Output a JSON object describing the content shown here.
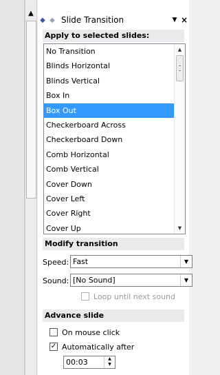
{
  "pane": {
    "title": "Slide Transition",
    "back_icon": "back-arrow-icon",
    "forward_icon": "forward-arrow-icon",
    "menu_icon": "dropdown-triangle-icon",
    "close_icon": "close-icon"
  },
  "apply_section": {
    "title": "Apply to selected slides:",
    "items": [
      "No Transition",
      "Blinds Horizontal",
      "Blinds Vertical",
      "Box In",
      "Box Out",
      "Checkerboard Across",
      "Checkerboard Down",
      "Comb Horizontal",
      "Comb Vertical",
      "Cover Down",
      "Cover Left",
      "Cover Right",
      "Cover Up"
    ],
    "selected": "Box Out"
  },
  "modify_section": {
    "title": "Modify transition",
    "speed_label": "Speed:",
    "speed_value": "Fast",
    "sound_label": "Sound:",
    "sound_value": "[No Sound]",
    "loop_label": "Loop until next sound",
    "loop_checked": false
  },
  "advance_section": {
    "title": "Advance slide",
    "mouse_click_label": "On mouse click",
    "mouse_click_checked": false,
    "auto_label": "Automatically after",
    "auto_checked": true,
    "auto_time": "00:03"
  },
  "colors": {
    "selection": "#3399ff",
    "section_header_bg": "#e8eaec"
  }
}
